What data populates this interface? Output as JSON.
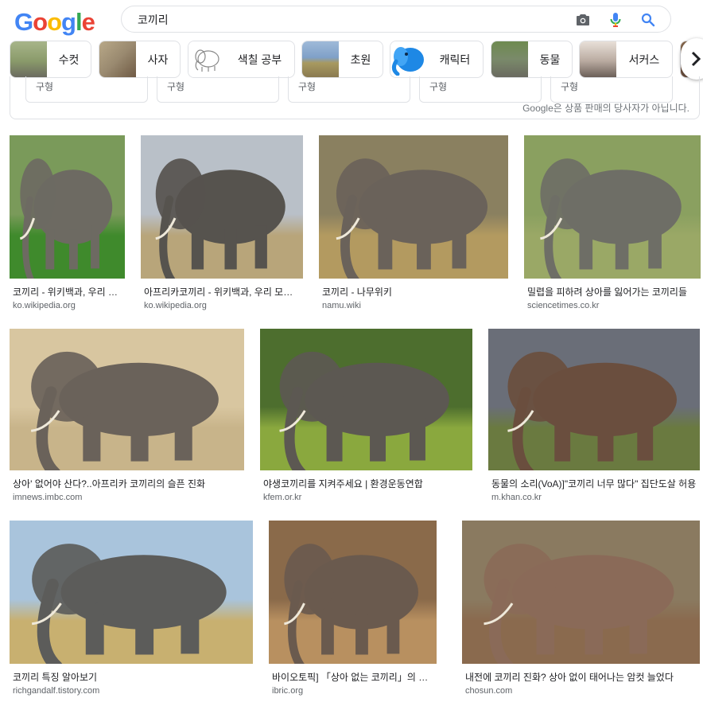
{
  "logo": {
    "letters": [
      "G",
      "o",
      "o",
      "g",
      "l",
      "e"
    ]
  },
  "search": {
    "value": "코끼리"
  },
  "chips": [
    {
      "label": "수컷",
      "colors": [
        "#8a9a6a",
        "#6b6b60"
      ]
    },
    {
      "label": "사자",
      "colors": [
        "#9a8a70",
        "#6f5a44"
      ]
    },
    {
      "label": "색칠 공부",
      "colors": [
        "#ffffff",
        "#999999"
      ]
    },
    {
      "label": "초원",
      "colors": [
        "#7fa0c8",
        "#8a7a50"
      ]
    },
    {
      "label": "캐릭터",
      "colors": [
        "#ffffff",
        "#1e88e5"
      ]
    },
    {
      "label": "동물",
      "colors": [
        "#6e8a50",
        "#6a6a60"
      ]
    },
    {
      "label": "서커스",
      "colors": [
        "#e8e0d8",
        "#6b5f58"
      ]
    }
  ],
  "filters": {
    "boxes": [
      "구형",
      "구형",
      "구형",
      "구형",
      "구형"
    ],
    "disclaimer": "Google은 상품 판매의 당사자가 아닙니다."
  },
  "results": [
    {
      "title": "코끼리 - 위키백과, 우리 모두의 백과사전",
      "source": "ko.wikipedia.org",
      "sky": "#7a9a5a",
      "ground": "#3f8a2c",
      "body": "#6d6a62"
    },
    {
      "title": "아프리카코끼리 - 위키백과, 우리 모두의 백과사전",
      "source": "ko.wikipedia.org",
      "sky": "#b9c0c8",
      "ground": "#b8a57a",
      "body": "#56534e"
    },
    {
      "title": "코끼리 - 나무위키",
      "source": "namu.wiki",
      "sky": "#8a8060",
      "ground": "#b39a60",
      "body": "#6a625a"
    },
    {
      "title": "밀렵을 피하려 상아를 잃어가는 코끼리들",
      "source": "sciencetimes.co.kr",
      "sky": "#8aa060",
      "ground": "#9aa866",
      "body": "#6e6e66"
    },
    {
      "title": "상아' 없어야 산다?..아프리카 코끼리의 슬픈 진화",
      "source": "imnews.imbc.com",
      "sky": "#d8c6a0",
      "ground": "#c8b48a",
      "body": "#6a625a"
    },
    {
      "title": "야생코끼리를 지켜주세요 | 환경운동연합",
      "source": "kfem.or.kr",
      "sky": "#4d6e2e",
      "ground": "#8aa83e",
      "body": "#5c5852"
    },
    {
      "title": "동물의 소리(VoA)]\"코끼리 너무 많다\" 집단도살 허용",
      "source": "m.khan.co.kr",
      "sky": "#6a6e78",
      "ground": "#6a7a40",
      "body": "#6a4e3e"
    },
    {
      "title": "코끼리 특징 알아보기",
      "source": "richgandalf.tistory.com",
      "sky": "#a9c4dc",
      "ground": "#c8b070",
      "body": "#5c5c5a"
    },
    {
      "title": "바이오토픽] 「상아 없는 코끼리」의 진화",
      "source": "ibric.org",
      "sky": "#8a6a4a",
      "ground": "#b89060",
      "body": "#6a5a4e"
    },
    {
      "title": "내전에 코끼리 진화? 상아 없이 태어나는 암컷 늘었다",
      "source": "chosun.com",
      "sky": "#8a7a60",
      "ground": "#8a6a4e",
      "body": "#8a6a58"
    }
  ]
}
